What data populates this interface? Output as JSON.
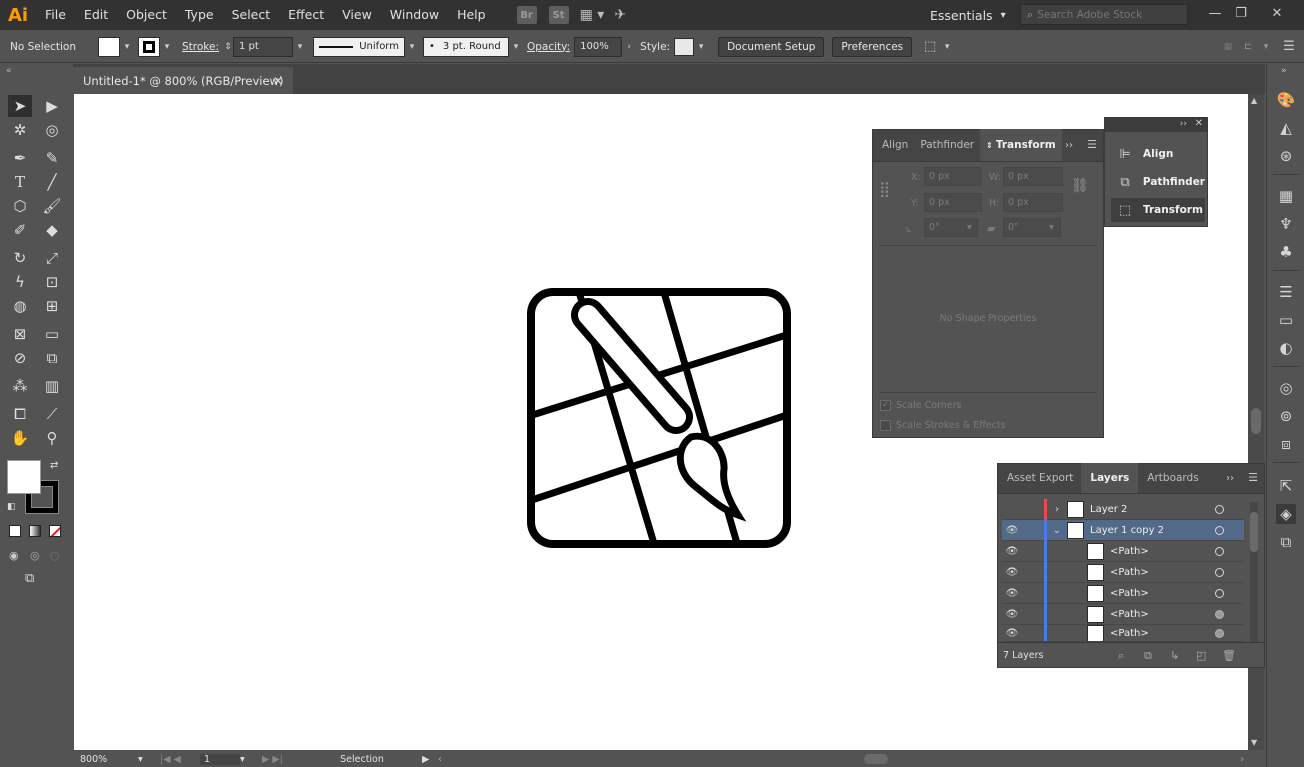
{
  "app": {
    "logo": "Ai",
    "menu": [
      "File",
      "Edit",
      "Object",
      "Type",
      "Select",
      "Effect",
      "View",
      "Window",
      "Help"
    ],
    "bridge": "Br",
    "stock": "St",
    "workspace": "Essentials",
    "search_placeholder": "Search Adobe Stock"
  },
  "control_bar": {
    "selection_status": "No Selection",
    "stroke_label": "Stroke:",
    "stroke_weight": "1 pt",
    "profile": "Uniform",
    "brush": "3 pt. Round",
    "opacity_label": "Opacity:",
    "opacity": "100%",
    "style_label": "Style:",
    "document_setup": "Document Setup",
    "preferences": "Preferences"
  },
  "document": {
    "tab_title": "Untitled-1* @ 800% (RGB/Preview)",
    "zoom": "800%",
    "artboard": "1",
    "status": "Selection"
  },
  "transform_panel": {
    "tabs": [
      "Align",
      "Pathfinder",
      "Transform"
    ],
    "active_tab": "Transform",
    "x_label": "X:",
    "x": "0 px",
    "y_label": "Y:",
    "y": "0 px",
    "w_label": "W:",
    "w": "0 px",
    "h_label": "H:",
    "h": "0 px",
    "rotate": "0°",
    "shear": "0°",
    "no_shape": "No Shape Properties",
    "scale_corners": "Scale Corners",
    "scale_strokes": "Scale Strokes & Effects"
  },
  "collapsed_panel": {
    "items": [
      "Align",
      "Pathfinder",
      "Transform"
    ]
  },
  "layers_panel": {
    "tabs": [
      "Asset Export",
      "Layers",
      "Artboards"
    ],
    "active_tab": "Layers",
    "rows": [
      {
        "name": "Layer 2",
        "color": "#e84a4a"
      },
      {
        "name": "Layer 1 copy 2",
        "color": "#4a7ae8"
      },
      {
        "name": "<Path>",
        "color": "#4a7ae8"
      },
      {
        "name": "<Path>",
        "color": "#4a7ae8"
      },
      {
        "name": "<Path>",
        "color": "#4a7ae8"
      },
      {
        "name": "<Path>",
        "color": "#4a7ae8"
      },
      {
        "name": "<Path>",
        "color": "#4a7ae8"
      }
    ],
    "count": "7 Layers"
  },
  "colors": {
    "accent_logo": "#ff9a00",
    "selected_row": "#526a88"
  }
}
